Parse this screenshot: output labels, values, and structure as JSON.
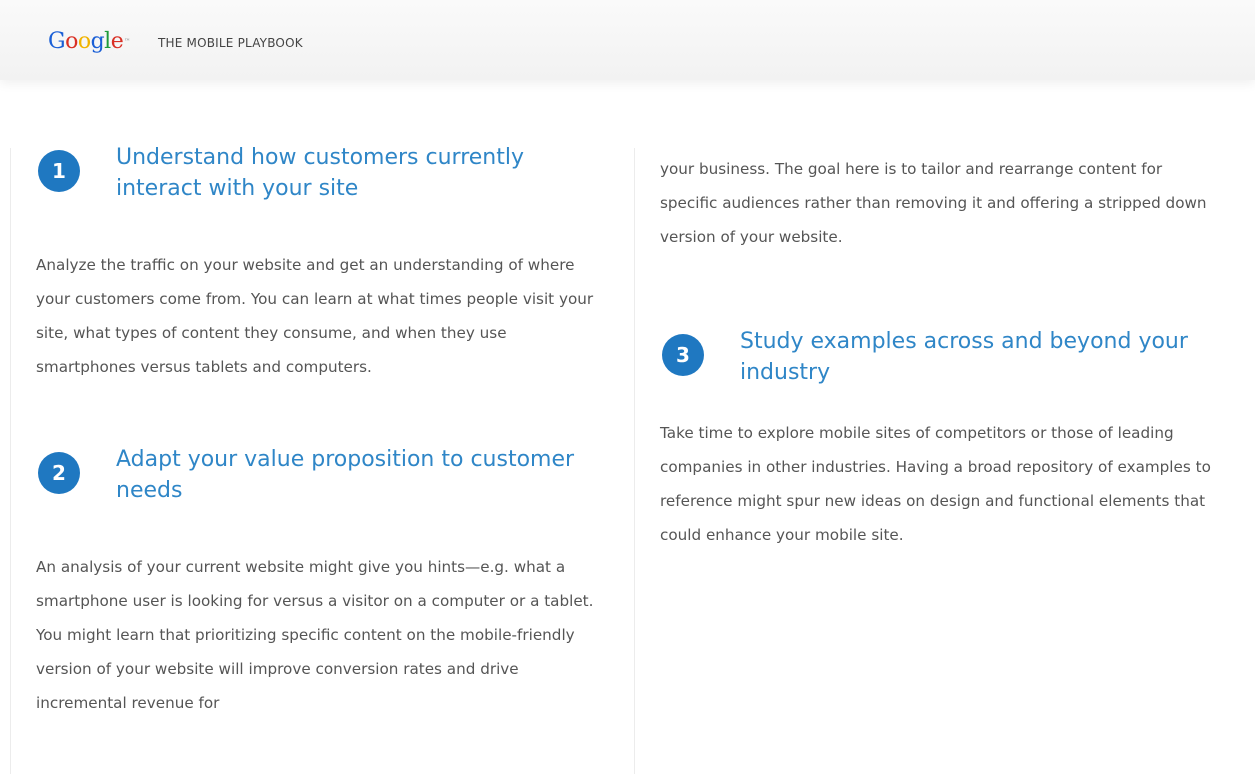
{
  "header": {
    "logo_text": "Google",
    "logo_letters": [
      "G",
      "o",
      "o",
      "g",
      "l",
      "e"
    ],
    "title": "THE MOBILE PLAYBOOK"
  },
  "colors": {
    "accent": "#2f86c7",
    "badge": "#1f78c1",
    "body_text": "#555555"
  },
  "steps": [
    {
      "number": "1",
      "title": "Understand how customers currently interact with your site",
      "body": "Analyze the traffic on your website and get an understanding of where your customers come from. You can learn at what times people visit your site, what types of content they consume, and when they use smartphones versus tablets and computers."
    },
    {
      "number": "2",
      "title": "Adapt your value proposition to customer needs",
      "body": "An analysis of your current website might give you hints—e.g. what a smartphone user is looking for versus a visitor on a computer or a tablet. You might learn that prioritizing specific content on the mobile-friendly version of your website will improve conversion rates and drive incremental revenue for"
    },
    {
      "number": "3",
      "title": "Study examples across and beyond your industry",
      "body": "Take time to explore mobile sites of competitors or those of leading companies in other industries. Having a broad repository of examples to reference might spur new ideas on design and functional elements that could enhance your mobile site."
    }
  ],
  "continuation": "your business. The goal here is to tailor and rearrange content for specific audiences rather than removing it and offering a stripped down version of your website."
}
